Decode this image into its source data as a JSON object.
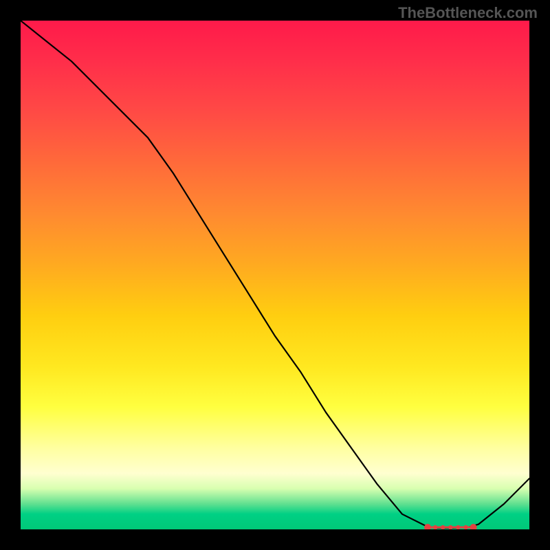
{
  "watermark": "TheBottleneck.com",
  "chart_data": {
    "type": "line",
    "title": "",
    "xlabel": "",
    "ylabel": "",
    "xlim": [
      0,
      100
    ],
    "ylim": [
      0,
      100
    ],
    "grid": false,
    "series": [
      {
        "name": "curve",
        "color": "#000000",
        "x": [
          0,
          5,
          10,
          15,
          20,
          25,
          30,
          35,
          40,
          45,
          50,
          55,
          60,
          65,
          70,
          75,
          80,
          82,
          85,
          88,
          90,
          95,
          100
        ],
        "values": [
          100,
          96,
          92,
          87,
          82,
          77,
          70,
          62,
          54,
          46,
          38,
          31,
          23,
          16,
          9,
          3,
          0.5,
          0.3,
          0.3,
          0.4,
          1,
          5,
          10
        ]
      },
      {
        "name": "markers",
        "color": "#e34040",
        "type_hint": "scatter",
        "x": [
          80,
          81.5,
          83,
          84.5,
          86,
          87.5,
          89
        ],
        "values": [
          0.4,
          0.4,
          0.4,
          0.4,
          0.4,
          0.4,
          0.4
        ]
      }
    ],
    "gradient_stops": [
      {
        "pos": 0.0,
        "color": "#ff1a4a"
      },
      {
        "pos": 0.5,
        "color": "#ffcc10"
      },
      {
        "pos": 0.8,
        "color": "#ffff60"
      },
      {
        "pos": 0.92,
        "color": "#d8ffb0"
      },
      {
        "pos": 1.0,
        "color": "#00c878"
      }
    ]
  }
}
